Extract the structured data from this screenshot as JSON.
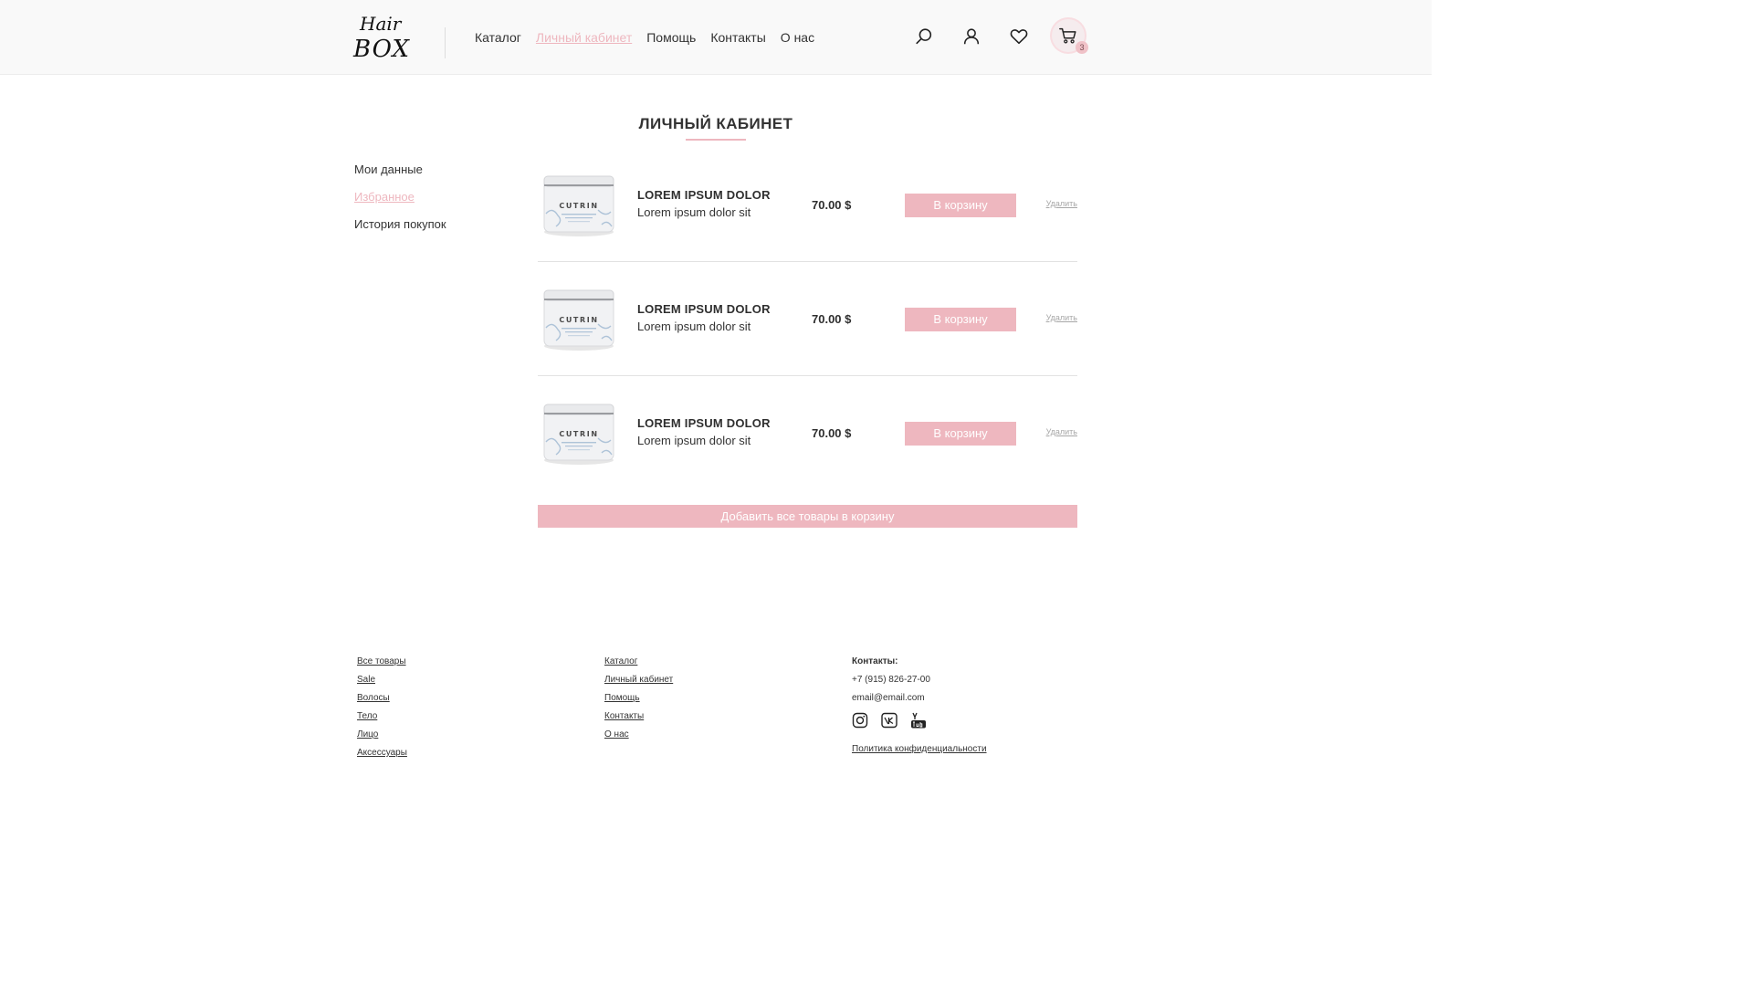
{
  "brand": {
    "logo_line1": "Hair",
    "logo_line2": "BOX"
  },
  "colors": {
    "accent": "#eeb7bf",
    "text": "#333333",
    "muted": "#a7a7a7"
  },
  "nav": {
    "items": [
      {
        "label": "Каталог",
        "active": false
      },
      {
        "label": "Личный кабинет",
        "active": true
      },
      {
        "label": "Помощь",
        "active": false
      },
      {
        "label": "Контакты",
        "active": false
      },
      {
        "label": "О нас",
        "active": false
      }
    ]
  },
  "header_icons": [
    "search-icon",
    "user-icon",
    "heart-icon",
    "cart-icon"
  ],
  "cart": {
    "count": "3"
  },
  "page": {
    "title": "ЛИЧНЫЙ КАБИНЕТ"
  },
  "sidebar": {
    "items": [
      {
        "label": "Мои данные",
        "active": false
      },
      {
        "label": "Избранное",
        "active": true
      },
      {
        "label": "История покупок",
        "active": false
      }
    ]
  },
  "favorites": {
    "items": [
      {
        "name": "LOREM IPSUM DOLOR",
        "desc": "Lorem ipsum dolor sit",
        "price": "70.00 $",
        "button": "В корзину",
        "remove": "Удалить",
        "jar_brand": "CUTRIN"
      },
      {
        "name": "LOREM IPSUM DOLOR",
        "desc": "Lorem ipsum dolor sit",
        "price": "70.00 $",
        "button": "В корзину",
        "remove": "Удалить",
        "jar_brand": "CUTRIN"
      },
      {
        "name": "LOREM IPSUM DOLOR",
        "desc": "Lorem ipsum dolor sit",
        "price": "70.00 $",
        "button": "В корзину",
        "remove": "Удалить",
        "jar_brand": "CUTRIN"
      }
    ],
    "add_all": "Добавить все товары в корзину"
  },
  "footer": {
    "col1": [
      "Все товары",
      "Sale",
      "Волосы",
      "Тело",
      "Лицо",
      "Аксессуары"
    ],
    "col2": [
      "Каталог",
      "Личный кабинет",
      "Помощь",
      "Контакты",
      "О нас"
    ],
    "contacts": {
      "heading": "Контакты:",
      "phone": "+7 (915) 826-27-00",
      "email": "email@email.com",
      "socials": [
        "instagram-icon",
        "vk-icon",
        "youtube-icon"
      ],
      "privacy": "Политика конфиденциальности"
    }
  }
}
